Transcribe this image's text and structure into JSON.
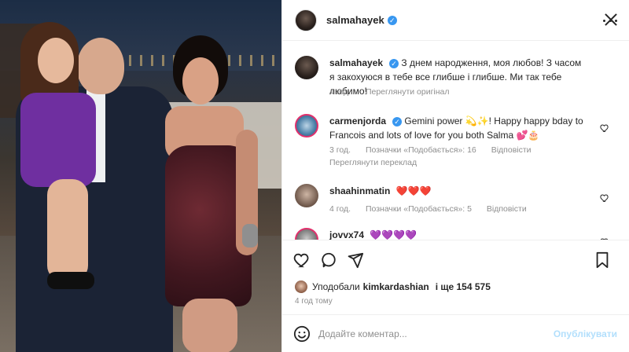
{
  "post": {
    "author": "salmahayek",
    "verified": true
  },
  "caption": {
    "user": "salmahayek",
    "text": "З днем народження, моя любов! З часом я закохуюся в тебе все глибше і глибше. Ми так тебе любимо!",
    "time": "4 год.",
    "action": "Переглянути оригінал"
  },
  "comments": [
    {
      "user": "carmenjorda",
      "verified": true,
      "text": "Gemini power 💫✨! Happy happy bday to Francois and lots of love for you both Salma 💕🎂",
      "time": "3 год.",
      "likes": "Позначки «Подобається»: 16",
      "reply": "Відповісти",
      "secondary": "Переглянути переклад"
    },
    {
      "user": "shaahinmatin",
      "verified": false,
      "text": "❤️❤️❤️",
      "time": "4 год.",
      "likes": "Позначки «Подобається»: 5",
      "reply": "Відповісти"
    },
    {
      "user": "jovvx74",
      "verified": false,
      "text": "💜💜💜💜"
    }
  ],
  "likes": {
    "prefix": "Уподобали",
    "user": "kimkardashian",
    "suffix": "і ще 154 575"
  },
  "timeago": "4 год тому",
  "input": {
    "placeholder": "Додайте коментар...",
    "publish": "Опублікувати"
  },
  "colors": {
    "verified": "#3897f0",
    "publish_disabled": "#b2dffc",
    "heart_red": "#ed4956"
  },
  "icons": [
    "more-horizontal-icon",
    "heart-outline-icon",
    "comment-icon",
    "share-icon",
    "bookmark-icon",
    "emoji-icon",
    "close-icon"
  ]
}
